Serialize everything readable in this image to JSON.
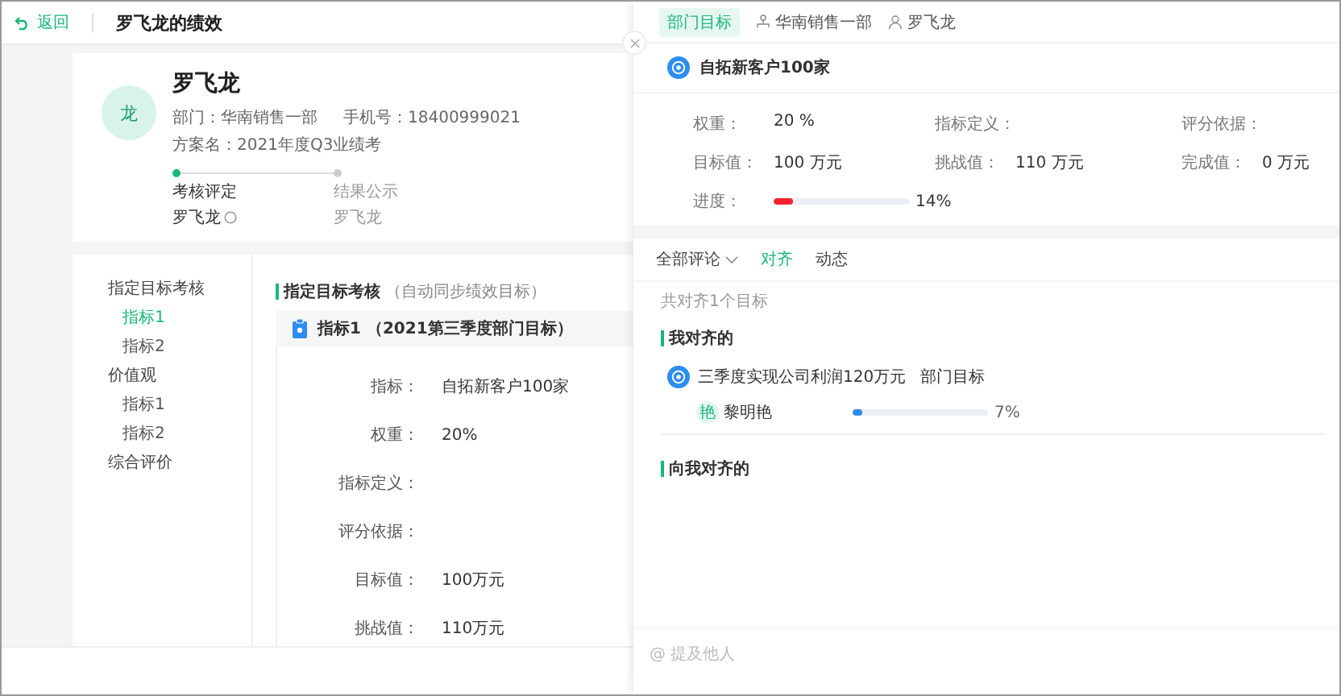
{
  "header": {
    "back": "返回",
    "title": "罗飞龙的绩效"
  },
  "profile": {
    "avatar": "龙",
    "name": "罗飞龙",
    "info": [
      "部门：华南销售一部",
      "手机号：18400999021",
      "方案名：2021年度Q3业绩考"
    ],
    "steps": [
      {
        "title": "考核评定",
        "person": "罗飞龙",
        "current": true
      },
      {
        "title": "结果公示",
        "person": "罗飞龙",
        "current": false
      }
    ]
  },
  "nav": [
    {
      "label": "指定目标考核",
      "selected": false,
      "children": [
        {
          "label": "指标1",
          "selected": true
        },
        {
          "label": "指标2",
          "selected": false
        }
      ]
    },
    {
      "label": "价值观",
      "selected": false,
      "children": [
        {
          "label": "指标1",
          "selected": false
        },
        {
          "label": "指标2",
          "selected": false
        }
      ]
    },
    {
      "label": "综合评价",
      "selected": false
    }
  ],
  "section": {
    "title": "指定目标考核",
    "note": "（自动同步绩效目标）",
    "indicator": "指标1 （2021第三季度部门目标）",
    "fields": [
      {
        "label": "指标：",
        "value": "自拓新客户100家"
      },
      {
        "label": "权重：",
        "value": "20%"
      },
      {
        "label": "指标定义："
      },
      {
        "label": "评分依据："
      },
      {
        "label": "目标值：",
        "value": "100万元"
      },
      {
        "label": "挑战值：",
        "value": "110万元"
      }
    ]
  },
  "drawer": {
    "tag": "部门目标",
    "department": "华南销售一部",
    "owner": "罗飞龙",
    "goal": "自拓新客户100家",
    "fields": [
      {
        "label": "权重：",
        "value": "20 %"
      },
      {
        "label": "指标定义："
      },
      {
        "label": "评分依据："
      },
      {
        "label": "目标值：",
        "value": "100 万元"
      },
      {
        "label": "挑战值：",
        "value": "110 万元"
      },
      {
        "label": "完成值：",
        "value": "0 万元"
      }
    ],
    "progress": {
      "label": "进度：",
      "level": 0.14,
      "reading": "14%"
    },
    "tabs": [
      {
        "label": "全部评论",
        "kind": "dropdown",
        "selected": false
      },
      {
        "label": "对齐",
        "kind": "plain",
        "selected": true
      },
      {
        "label": "动态",
        "kind": "plain",
        "selected": false
      }
    ],
    "summary": "共对齐1个目标",
    "sections": [
      {
        "title": "我对齐的",
        "items": [
          {
            "goal": "三季度实现公司利润120万元",
            "tag": "部门目标",
            "avatar": "艳",
            "person": "黎明艳",
            "level": 0.07,
            "reading": "7%"
          }
        ]
      },
      {
        "title": "向我对齐的"
      }
    ],
    "comment": {
      "placeholder": "@ 提及他人"
    }
  }
}
